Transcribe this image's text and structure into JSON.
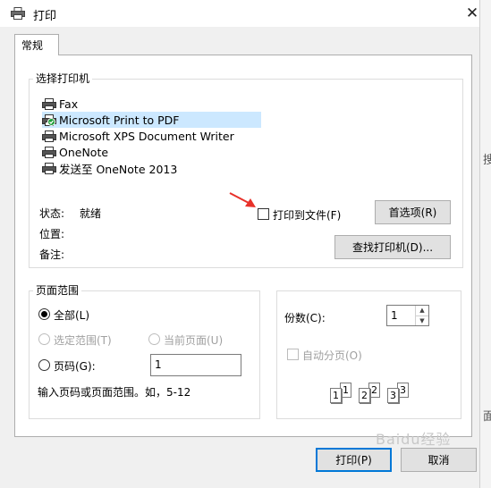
{
  "window": {
    "title": "打印",
    "close_glyph": "✕"
  },
  "background_app": {
    "char1": "搜",
    "char2": "面"
  },
  "tabs": [
    {
      "label": "常规"
    }
  ],
  "select_printer": {
    "group_label": "选择打印机",
    "printers": [
      {
        "label": "Fax",
        "icon": "fax-printer-icon",
        "selected": false
      },
      {
        "label": "Microsoft Print to PDF",
        "icon": "default-printer-icon",
        "selected": true
      },
      {
        "label": "Microsoft XPS Document Writer",
        "icon": "printer-icon",
        "selected": false
      },
      {
        "label": "OneNote",
        "icon": "printer-icon",
        "selected": false
      },
      {
        "label": "发送至 OneNote 2013",
        "icon": "printer-icon",
        "selected": false
      }
    ],
    "status_label": "状态:",
    "status_value": "就绪",
    "location_label": "位置:",
    "comment_label": "备注:",
    "print_to_file_label": "打印到文件(F)",
    "print_to_file_checked": false,
    "preferences_button": "首选项(R)",
    "find_printer_button": "查找打印机(D)..."
  },
  "page_range": {
    "group_label": "页面范围",
    "all_label": "全部(L)",
    "all_selected": true,
    "selection_label": "选定范围(T)",
    "current_page_label": "当前页面(U)",
    "pages_label": "页码(G):",
    "pages_value": "1",
    "hint": "输入页码或页面范围。如，5-12"
  },
  "copies": {
    "count_label": "份数(C):",
    "count_value": "1",
    "collate_label": "自动分页(O)",
    "collate_checked": false,
    "collate_pages": [
      "1",
      "1",
      "2",
      "2",
      "3",
      "3"
    ]
  },
  "footer": {
    "print_button": "打印(P)",
    "cancel_button": "取消"
  },
  "watermark": "Baidu经验",
  "colors": {
    "selection": "#cce8ff",
    "default_button_border": "#0078d7",
    "annotation_arrow": "#e8312a"
  }
}
